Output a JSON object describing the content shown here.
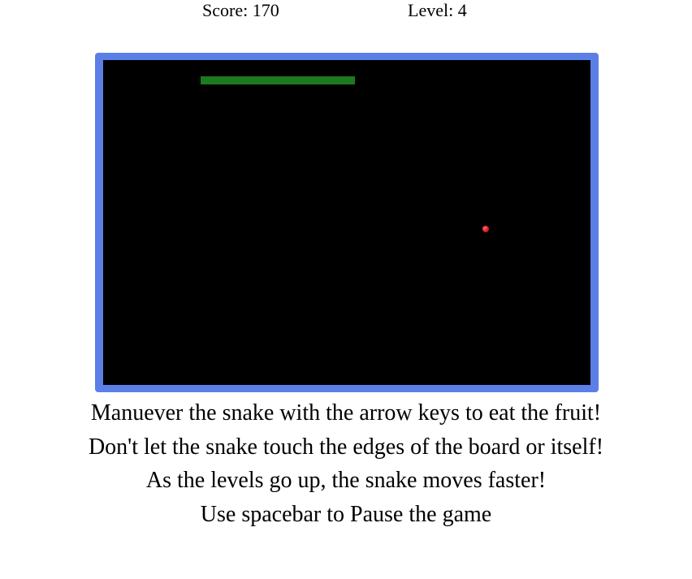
{
  "hud": {
    "score": "Score: 170",
    "level": "Level: 4"
  },
  "board": {
    "frame_color": "#5b7fe6",
    "background_color": "#000000",
    "snake_color": "#1e7a1e",
    "fruit_color": "#e01b24"
  },
  "instructions": [
    "Manuever the snake with the arrow keys to eat the fruit!",
    "Don't let the snake touch the edges of the board or itself!",
    "As the levels go up, the snake moves faster!",
    "Use spacebar to Pause the game"
  ]
}
